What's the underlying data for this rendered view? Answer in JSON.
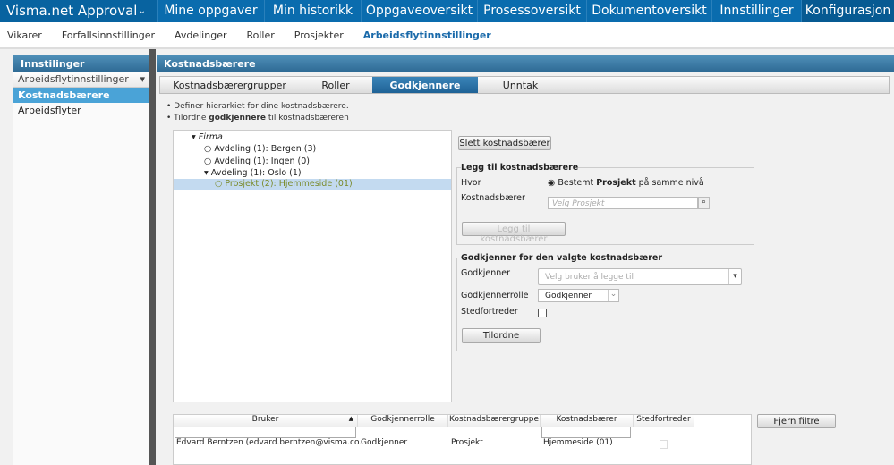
{
  "app": {
    "title": "Visma.net Approval"
  },
  "topnav": [
    "Mine oppgaver",
    "Min historikk",
    "Oppgaveoversikt",
    "Prosessoversikt",
    "Dokumentoversikt",
    "Innstillinger",
    "Konfigurasjon"
  ],
  "subnav": [
    "Vikarer",
    "Forfallsinnstillinger",
    "Avdelinger",
    "Roller",
    "Prosjekter",
    "Arbeidsflytinnstillinger"
  ],
  "sidebar": {
    "title": "Innstilinger",
    "select": "Arbeidsflytinnstillinger",
    "items": [
      "Kostnadsbærere",
      "Arbeidsflyter"
    ]
  },
  "content": {
    "title": "Kostnadsbærere",
    "wizard": [
      "Kostnadsbærergrupper",
      "Roller",
      "Godkjennere",
      "Unntak"
    ],
    "bullet1": "Definer hierarkiet for dine kostnadsbærere.",
    "bullet2_pre": "Tilordne ",
    "bullet2_bold": "godkjennere",
    "bullet2_post": " til kostnadsbæreren",
    "tree": [
      "Firma",
      "Avdeling (1): Bergen (3)",
      "Avdeling (1): Ingen (0)",
      "Avdeling (1): Oslo (1)",
      "Prosjekt (2): Hjemmeside (01)"
    ],
    "delete_button": "Slett kostnadsbærer",
    "add": {
      "legend": "Legg til kostnadsbærere",
      "where_label": "Hvor",
      "radio_pre": "Bestemt ",
      "radio_bold": "Prosjekt",
      "radio_post": " på samme nivå",
      "cc_label": "Kostnadsbærer",
      "cc_placeholder": "Velg Prosjekt",
      "add_button": "Legg til kostnadsbærer"
    },
    "approver": {
      "legend": "Godkjenner for den valgte kostnadsbærer",
      "approver_label": "Godkjenner",
      "approver_placeholder": "Velg bruker å legge til",
      "role_label": "Godkjennerrolle",
      "role_value": "Godkjenner",
      "sub_label": "Stedfortreder",
      "assign_button": "Tilordne"
    },
    "grid": {
      "headers": [
        "Bruker",
        "Godkjennerrolle",
        "Kostnadsbærergruppe",
        "Kostnadsbærer",
        "Stedfortreder"
      ],
      "rows": [
        [
          "Edvard Berntzen (edvard.berntzen@visma.co...",
          "Godkjenner",
          "Prosjekt",
          "Hjemmeside (01)"
        ]
      ]
    },
    "clear_filters": "Fjern filtre"
  }
}
